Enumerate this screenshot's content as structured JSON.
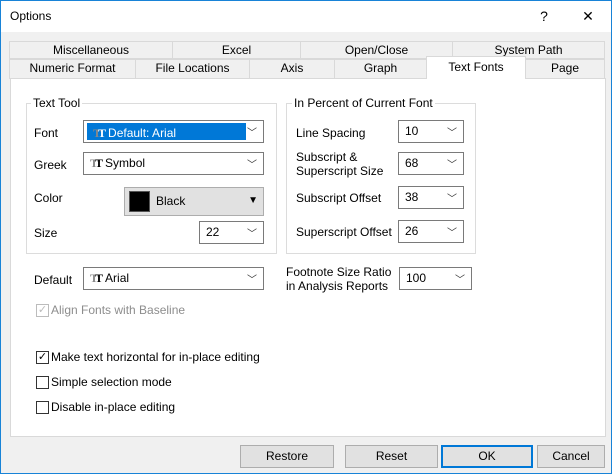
{
  "window": {
    "title": "Options",
    "help": "?",
    "close": "✕"
  },
  "tabs_row1": [
    "Miscellaneous",
    "Excel",
    "Open/Close",
    "System Path"
  ],
  "tabs_row2": [
    "Numeric Format",
    "File Locations",
    "Axis",
    "Graph",
    "Text Fonts",
    "Page"
  ],
  "active_tab": "Text Fonts",
  "text_tool": {
    "legend": "Text Tool",
    "font_label": "Font",
    "font_value": "Default: Arial",
    "greek_label": "Greek",
    "greek_value": "Symbol",
    "color_label": "Color",
    "color_value": "Black",
    "color_swatch": "#000000",
    "size_label": "Size",
    "size_value": "22"
  },
  "percent": {
    "legend": "In Percent of Current Font",
    "line_spacing_label": "Line Spacing",
    "line_spacing_value": "10",
    "subsup_label_1": "Subscript &",
    "subsup_label_2": "Superscript Size",
    "subsup_value": "68",
    "sub_offset_label": "Subscript Offset",
    "sub_offset_value": "38",
    "sup_offset_label": "Superscript Offset",
    "sup_offset_value": "26"
  },
  "default": {
    "label": "Default",
    "value": "Arial"
  },
  "footnote": {
    "label_1": "Footnote Size Ratio",
    "label_2": "in Analysis Reports",
    "value": "100"
  },
  "checkboxes": {
    "align": {
      "label": "Align Fonts with Baseline",
      "checked": true,
      "disabled": true
    },
    "horizontal": {
      "label": "Make text horizontal for in-place editing",
      "checked": true
    },
    "simple": {
      "label": "Simple selection mode",
      "checked": false
    },
    "disable": {
      "label": "Disable in-place editing",
      "checked": false
    }
  },
  "buttons": {
    "restore": "Restore",
    "reset": "Reset",
    "ok": "OK",
    "cancel": "Cancel"
  },
  "glyphs": {
    "check": "✓",
    "chevron": "﹀",
    "tt": "T",
    "triangle": "▼"
  }
}
